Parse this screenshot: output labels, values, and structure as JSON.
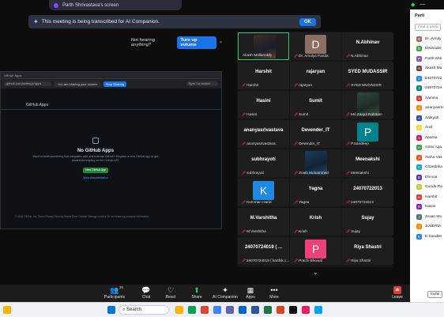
{
  "share_bar": {
    "text": "Parth Shrivastava's screen"
  },
  "ai_notice": {
    "text": "This meeting is being transcribed for AI Companion.",
    "ok_label": "OK"
  },
  "hearing_bar": {
    "text": "Not hearing anything?",
    "button": "Turn up volume",
    "close": "×"
  },
  "shared_screen": {
    "url": "github.com/settings/apps",
    "banner": "You are sharing your screen",
    "stop_label": "Stop Sharing",
    "search_text": "Type / to search",
    "section_title": "GitHub Apps",
    "empty_heading": "No GitHub Apps",
    "empty_text": "Want to build something that integrates with and extends GitHub? Register a new GitHub App to get started developing on the GitHub API.",
    "new_app_button": "New GitHub App",
    "docs_link": "View documentation",
    "footer": "© 2024 GitHub, Inc.   Terms   Privacy   Security   Status   Docs   Contact   Manage cookies   Do not share my personal information"
  },
  "gallery": {
    "tiles": [
      {
        "name": "",
        "label": "Akash Mallareddy",
        "avatar": "photo",
        "color": "",
        "muted": false,
        "active": true
      },
      {
        "name": "",
        "label": "Dr. Amulya Panda",
        "avatar": "D",
        "color": "#8d6e63",
        "muted": true
      },
      {
        "name": "N.Abhinav",
        "label": "N.Abhinav",
        "avatar": "",
        "color": "",
        "muted": true
      },
      {
        "name": "Harshit",
        "label": "Harshit",
        "avatar": "",
        "color": "",
        "muted": true
      },
      {
        "name": "rajaryan",
        "label": "rajaryan",
        "avatar": "",
        "color": "",
        "muted": true
      },
      {
        "name": "SYED MUDASSIR",
        "label": "SYED MUDASSIR",
        "avatar": "",
        "color": "",
        "muted": true
      },
      {
        "name": "Hasini",
        "label": "Hasini",
        "avatar": "",
        "color": "",
        "muted": true
      },
      {
        "name": "Sumit",
        "label": "Sumit",
        "avatar": "",
        "color": "",
        "muted": true
      },
      {
        "name": "",
        "label": "Md Zaiqul Rahman",
        "avatar": "photo-b",
        "color": "",
        "muted": true
      },
      {
        "name": "ananyasrivastava",
        "label": "ananyasrivastava",
        "avatar": "",
        "color": "",
        "muted": true
      },
      {
        "name": "Devender_IT",
        "label": "Devender_IT",
        "avatar": "",
        "color": "",
        "muted": true
      },
      {
        "name": "",
        "label": "P.Sandeep",
        "avatar": "P",
        "color": "#00838f",
        "muted": true
      },
      {
        "name": "subhrayoti",
        "label": "subhrayoti",
        "avatar": "",
        "color": "",
        "muted": true
      },
      {
        "name": "",
        "label": "Zoaib Mohammed",
        "avatar": "photo-c",
        "color": "",
        "muted": true
      },
      {
        "name": "Meenakshi",
        "label": "Meenakshi",
        "avatar": "",
        "color": "",
        "muted": true
      },
      {
        "name": "",
        "label": "Kumman Harini",
        "avatar": "K",
        "color": "#1e88e5",
        "muted": true
      },
      {
        "name": "Yagna",
        "label": "Yagna",
        "avatar": "",
        "color": "",
        "muted": true
      },
      {
        "name": "24070722013",
        "label": "24070722013",
        "avatar": "",
        "color": "",
        "muted": true
      },
      {
        "name": "M.Varshitha",
        "label": "M.Varshitha",
        "avatar": "",
        "color": "",
        "muted": true
      },
      {
        "name": "Krish",
        "label": "Krish",
        "avatar": "",
        "color": "",
        "muted": true
      },
      {
        "name": "Sujay",
        "label": "Sujay",
        "avatar": "",
        "color": "",
        "muted": true
      },
      {
        "name": "24070724019 ( ...",
        "label": "24070724019 ( karthik c...",
        "avatar": "",
        "color": "",
        "muted": true
      },
      {
        "name": "",
        "label": "Prachi Bhowal",
        "avatar": "P",
        "color": "#ec407a",
        "muted": true
      },
      {
        "name": "Riya Shastri",
        "label": "Riya Shastri",
        "avatar": "",
        "color": "",
        "muted": true
      }
    ]
  },
  "participants": {
    "title": "Parti",
    "search_placeholder": "Find a partic",
    "items": [
      {
        "name": "Dr. Amuly",
        "initial": "D",
        "color": "#8d6e63"
      },
      {
        "name": "Devender",
        "initial": "D",
        "color": "#43a047"
      },
      {
        "name": "Parth Shri",
        "initial": "P",
        "color": "#7e57c2"
      },
      {
        "name": "Akash Ma",
        "initial": "A",
        "color": "#6d4c41"
      },
      {
        "name": "24070722",
        "initial": "2",
        "color": "#1e88e5"
      },
      {
        "name": "24070724",
        "initial": "2",
        "color": "#00897b"
      },
      {
        "name": "Aamina",
        "initial": "A",
        "color": "#e53935"
      },
      {
        "name": "ananyasriv",
        "initial": "A",
        "color": "#fb8c00"
      },
      {
        "name": "Aaleyah",
        "initial": "A",
        "color": "#3949ab"
      },
      {
        "name": "Anvi",
        "initial": "A",
        "color": "#fdd835"
      },
      {
        "name": "Aparna",
        "initial": "A",
        "color": "#d81b60"
      },
      {
        "name": "ASmi Aga",
        "initial": "A",
        "color": "#43a047"
      },
      {
        "name": "Atsha Vas",
        "initial": "A",
        "color": "#f4511e"
      },
      {
        "name": "Chandrika",
        "initial": "C",
        "color": "#00acc1"
      },
      {
        "name": "Dhruva",
        "initial": "D",
        "color": "#5e35b1"
      },
      {
        "name": "Gunda Ra",
        "initial": "G",
        "color": "#c0ca33"
      },
      {
        "name": "Harshit",
        "initial": "H",
        "color": "#e53935"
      },
      {
        "name": "Hasini",
        "initial": "H",
        "color": "#8e24aa"
      },
      {
        "name": "Jeoan Mo",
        "initial": "J",
        "color": "#546e7a"
      },
      {
        "name": "JUVERIA",
        "initial": "J",
        "color": "#fb8c00"
      },
      {
        "name": "K Sandee",
        "initial": "K",
        "color": "#1e88e5"
      }
    ],
    "invite_label": "Invite"
  },
  "toolbar": {
    "participants_label": "Participants",
    "participants_count": "36",
    "chat_label": "Chat",
    "react_label": "React",
    "share_label": "Share",
    "ai_label": "AI Companion",
    "apps_label": "Apps",
    "more_label": "More",
    "leave_label": "Leave"
  },
  "taskbar": {
    "search_label": "Search"
  },
  "colors": {
    "accent": "#1a73e8",
    "mute": "#e53935",
    "active_speaker": "#2ecc71",
    "share_green": "#2ecc71"
  }
}
